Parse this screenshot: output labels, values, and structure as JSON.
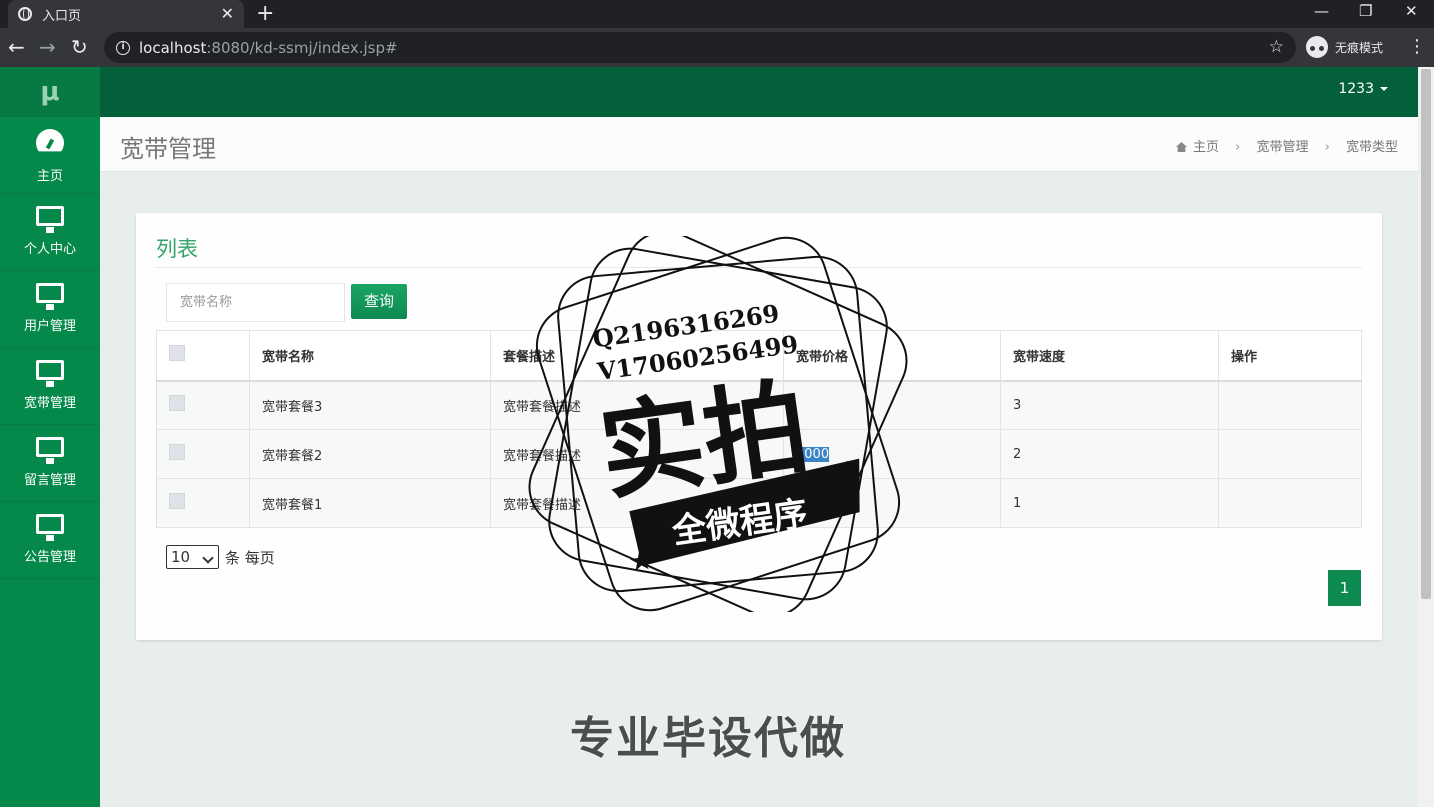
{
  "browser": {
    "tab_title": "入口页",
    "tab_close": "✕",
    "new_tab": "+",
    "url_host": "localhost",
    "url_path": ":8080/kd-ssmj/index.jsp#",
    "incognito_label": "无痕模式",
    "back_icon": "←",
    "forward_icon": "→",
    "reload_icon": "↻",
    "star_icon": "☆",
    "minimize_icon": "—",
    "restore_icon": "❐",
    "close_icon": "✕",
    "menu_icon": "⋮"
  },
  "sidebar": {
    "brand": "μ",
    "items": [
      {
        "label": "主页",
        "icon": "dashboard-icon"
      },
      {
        "label": "个人中心",
        "icon": "monitor-icon"
      },
      {
        "label": "用户管理",
        "icon": "monitor-icon"
      },
      {
        "label": "宽带管理",
        "icon": "monitor-icon"
      },
      {
        "label": "留言管理",
        "icon": "monitor-icon"
      },
      {
        "label": "公告管理",
        "icon": "monitor-icon"
      }
    ]
  },
  "header": {
    "user": "1233"
  },
  "page": {
    "title": "宽带管理",
    "breadcrumb": [
      "主页",
      "宽带管理",
      "宽带类型"
    ],
    "breadcrumb_sep": "›"
  },
  "panel": {
    "title": "列表",
    "search_placeholder": "宽带名称",
    "search_button": "查询"
  },
  "table": {
    "columns": [
      "宽带名称",
      "套餐描述",
      "宽带价格",
      "宽带速度",
      "操作"
    ],
    "rows": [
      {
        "name": "宽带套餐3",
        "desc": "宽带套餐描述",
        "price": "",
        "speed": "3",
        "ops": ""
      },
      {
        "name": "宽带套餐2",
        "desc": "宽带套餐描述",
        "price": "2000",
        "speed": "2",
        "ops": ""
      },
      {
        "name": "宽带套餐1",
        "desc": "宽带套餐描述",
        "price": "",
        "speed": "1",
        "ops": ""
      }
    ]
  },
  "pager": {
    "page_size": "10",
    "page_size_suffix": "条 每页",
    "current_page": "1"
  },
  "watermark": {
    "line1": "Q2196316269",
    "line2": "V17060256499",
    "main": "实拍",
    "ribbon": "全微程序",
    "bottom": "专业毕设代做"
  },
  "colors": {
    "sidebar": "#04894a",
    "header": "#03603a",
    "accent": "#34a46a",
    "button": "#0d8a50"
  }
}
